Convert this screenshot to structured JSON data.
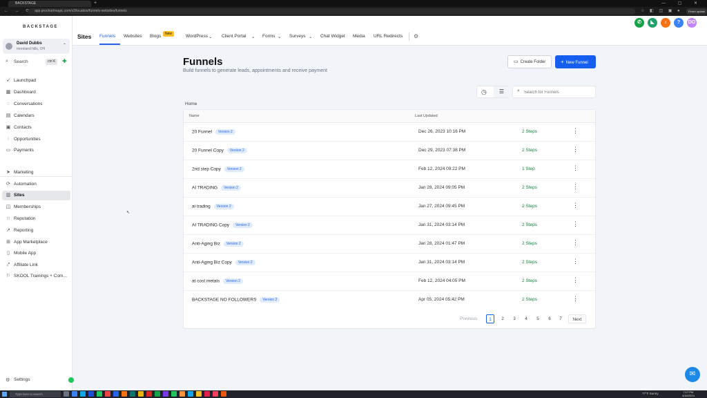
{
  "browser": {
    "tab_title": "BACKSTAGE",
    "url": "app.prochartmagic.com/v2/location/funnels-websites/funnels",
    "update_label": "Finish update"
  },
  "sidebar": {
    "logo": "BACKSTAGE",
    "account": {
      "name": "David Dubbs",
      "location": "moreland hills, OH"
    },
    "search": {
      "label": "Search",
      "shortcut": "ctrl K"
    },
    "items": [
      {
        "label": "Launchpad",
        "icon": "rocket-icon"
      },
      {
        "label": "Dashboard",
        "icon": "dashboard-icon"
      },
      {
        "label": "Conversations",
        "icon": "chat-icon"
      },
      {
        "label": "Calendars",
        "icon": "calendar-icon"
      },
      {
        "label": "Contacts",
        "icon": "contacts-icon"
      },
      {
        "label": "Opportunities",
        "icon": "filter-icon"
      },
      {
        "label": "Payments",
        "icon": "card-icon"
      },
      {
        "label": "Marketing",
        "icon": "send-icon"
      },
      {
        "label": "Automation",
        "icon": "automation-icon"
      },
      {
        "label": "Sites",
        "icon": "sites-icon"
      },
      {
        "label": "Memberships",
        "icon": "memberships-icon"
      },
      {
        "label": "Reputation",
        "icon": "star-icon"
      },
      {
        "label": "Reporting",
        "icon": "chart-icon"
      },
      {
        "label": "App Marketplace",
        "icon": "grid-icon"
      },
      {
        "label": "Mobile App",
        "icon": "phone-icon"
      },
      {
        "label": "Affiliate Link",
        "icon": "link-icon"
      },
      {
        "label": "SKOOL Trainings + Com...",
        "icon": "book-icon"
      }
    ],
    "settings_label": "Settings"
  },
  "header": {
    "section": "Sites",
    "tabs": [
      "Funnels",
      "Websites",
      "Blogs",
      "WordPress",
      "Client Portal",
      "Forms",
      "Surveys",
      "Chat Widget",
      "Media",
      "URL Redirects"
    ],
    "new_badge": "New",
    "avatar_initials": "DO",
    "help": "?"
  },
  "main": {
    "title": "Funnels",
    "subtitle": "Build funnels to generate leads, appointments and receive payment",
    "create_folder": "Create Folder",
    "new_funnel": "New Funnel",
    "search_placeholder": "Search for Funnels",
    "breadcrumb": "Home",
    "columns": {
      "name": "Name",
      "last_updated": "Last Updated"
    },
    "rows": [
      {
        "name": "20 Funnel",
        "version": "Version 2",
        "date": "Dec 26, 2023 10:16 PM",
        "steps": "2 Steps"
      },
      {
        "name": "20 Funnel Copy",
        "version": "Version 2",
        "date": "Dec 29, 2023 07:38 PM",
        "steps": "2 Steps"
      },
      {
        "name": "2nd step Copy",
        "version": "Version 2",
        "date": "Feb 12, 2024 09:22 PM",
        "steps": "1 Step"
      },
      {
        "name": "AI TRADING",
        "version": "Version 2",
        "date": "Jan 28, 2024 09:05 PM",
        "steps": "2 Steps"
      },
      {
        "name": "ai trading",
        "version": "Version 2",
        "date": "Jan 27, 2024 09:45 PM",
        "steps": "2 Steps"
      },
      {
        "name": "AI TRADING Copy",
        "version": "Version 2",
        "date": "Jan 31, 2024 03:14 PM",
        "steps": "2 Steps"
      },
      {
        "name": "Anti-Aging Biz",
        "version": "Version 2",
        "date": "Jan 28, 2024 01:47 PM",
        "steps": "2 Steps"
      },
      {
        "name": "Anti-Aging Biz Copy",
        "version": "Version 2",
        "date": "Jan 31, 2024 03:14 PM",
        "steps": "2 Steps"
      },
      {
        "name": "at cost metals",
        "version": "Version 2",
        "date": "Feb 12, 2024 04:05 PM",
        "steps": "2 Steps"
      },
      {
        "name": "BACKSTAGE NO FOLLOWERS",
        "version": "Version 2",
        "date": "Apr 05, 2024 05:42 PM",
        "steps": "2 Steps"
      }
    ],
    "pagination": {
      "previous": "Previous",
      "pages": [
        "1",
        "2",
        "3",
        "4",
        "5",
        "6",
        "7"
      ],
      "current": "1",
      "next": "Next"
    }
  },
  "taskbar": {
    "search_placeholder": "Type here to search",
    "weather": "77°F Sunny",
    "time": "7:17 PM",
    "date": "4/16/2024"
  },
  "colors": {
    "accent": "#155eef",
    "steps": "#15803d",
    "badge_bg": "#e0ecfb",
    "new_badge": "#fbbf24"
  }
}
